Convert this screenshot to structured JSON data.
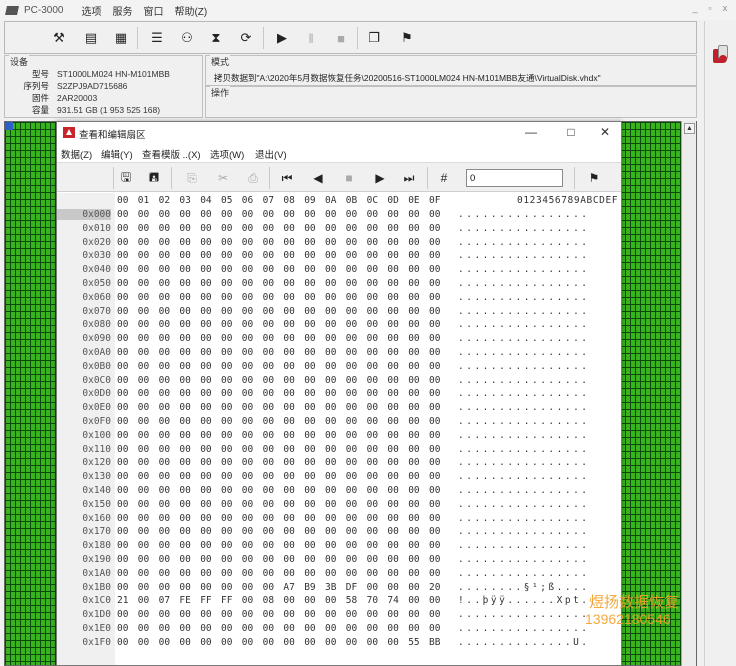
{
  "app": {
    "title": "PC-3000",
    "menu": [
      "选项",
      "服务",
      "窗口",
      "帮助(Z)"
    ],
    "window_controls": [
      "_",
      "▫",
      "x"
    ]
  },
  "device": {
    "caption": "设备",
    "fields": [
      {
        "label": "型号",
        "value": "ST1000LM024 HN-M101MBB"
      },
      {
        "label": "序列号",
        "value": "S2ZPJ9AD715686"
      },
      {
        "label": "固件",
        "value": "2AR20003"
      },
      {
        "label": "容量",
        "value": "931.51 GB (1 953 525 168)"
      }
    ]
  },
  "mode": {
    "caption": "模式",
    "text": "拷贝数据到\"A:\\2020年5月数据恢复任务\\20200516-ST1000LM024 HN-M101MBB友通\\VirtualDisk.vhdx\""
  },
  "operation": {
    "caption": "操作"
  },
  "editor": {
    "title": "查看和编辑扇区",
    "menu": [
      "数据(Z)",
      "编辑(Y)",
      "查看模版 ..(X)",
      "选项(W)",
      "退出(V)"
    ],
    "offset_value": "0",
    "column_headers": [
      "00",
      "01",
      "02",
      "03",
      "04",
      "05",
      "06",
      "07",
      "08",
      "09",
      "0A",
      "0B",
      "0C",
      "0D",
      "0E",
      "0F"
    ],
    "ascii_header": "0123456789ABCDEF",
    "rows": [
      {
        "addr": "0x000",
        "bytes": [
          "00",
          "00",
          "00",
          "00",
          "00",
          "00",
          "00",
          "00",
          "00",
          "00",
          "00",
          "00",
          "00",
          "00",
          "00",
          "00"
        ],
        "ascii": "................"
      },
      {
        "addr": "0x010",
        "bytes": [
          "00",
          "00",
          "00",
          "00",
          "00",
          "00",
          "00",
          "00",
          "00",
          "00",
          "00",
          "00",
          "00",
          "00",
          "00",
          "00"
        ],
        "ascii": "................"
      },
      {
        "addr": "0x020",
        "bytes": [
          "00",
          "00",
          "00",
          "00",
          "00",
          "00",
          "00",
          "00",
          "00",
          "00",
          "00",
          "00",
          "00",
          "00",
          "00",
          "00"
        ],
        "ascii": "................"
      },
      {
        "addr": "0x030",
        "bytes": [
          "00",
          "00",
          "00",
          "00",
          "00",
          "00",
          "00",
          "00",
          "00",
          "00",
          "00",
          "00",
          "00",
          "00",
          "00",
          "00"
        ],
        "ascii": "................"
      },
      {
        "addr": "0x040",
        "bytes": [
          "00",
          "00",
          "00",
          "00",
          "00",
          "00",
          "00",
          "00",
          "00",
          "00",
          "00",
          "00",
          "00",
          "00",
          "00",
          "00"
        ],
        "ascii": "................"
      },
      {
        "addr": "0x050",
        "bytes": [
          "00",
          "00",
          "00",
          "00",
          "00",
          "00",
          "00",
          "00",
          "00",
          "00",
          "00",
          "00",
          "00",
          "00",
          "00",
          "00"
        ],
        "ascii": "................"
      },
      {
        "addr": "0x060",
        "bytes": [
          "00",
          "00",
          "00",
          "00",
          "00",
          "00",
          "00",
          "00",
          "00",
          "00",
          "00",
          "00",
          "00",
          "00",
          "00",
          "00"
        ],
        "ascii": "................"
      },
      {
        "addr": "0x070",
        "bytes": [
          "00",
          "00",
          "00",
          "00",
          "00",
          "00",
          "00",
          "00",
          "00",
          "00",
          "00",
          "00",
          "00",
          "00",
          "00",
          "00"
        ],
        "ascii": "................"
      },
      {
        "addr": "0x080",
        "bytes": [
          "00",
          "00",
          "00",
          "00",
          "00",
          "00",
          "00",
          "00",
          "00",
          "00",
          "00",
          "00",
          "00",
          "00",
          "00",
          "00"
        ],
        "ascii": "................"
      },
      {
        "addr": "0x090",
        "bytes": [
          "00",
          "00",
          "00",
          "00",
          "00",
          "00",
          "00",
          "00",
          "00",
          "00",
          "00",
          "00",
          "00",
          "00",
          "00",
          "00"
        ],
        "ascii": "................"
      },
      {
        "addr": "0x0A0",
        "bytes": [
          "00",
          "00",
          "00",
          "00",
          "00",
          "00",
          "00",
          "00",
          "00",
          "00",
          "00",
          "00",
          "00",
          "00",
          "00",
          "00"
        ],
        "ascii": "................"
      },
      {
        "addr": "0x0B0",
        "bytes": [
          "00",
          "00",
          "00",
          "00",
          "00",
          "00",
          "00",
          "00",
          "00",
          "00",
          "00",
          "00",
          "00",
          "00",
          "00",
          "00"
        ],
        "ascii": "................"
      },
      {
        "addr": "0x0C0",
        "bytes": [
          "00",
          "00",
          "00",
          "00",
          "00",
          "00",
          "00",
          "00",
          "00",
          "00",
          "00",
          "00",
          "00",
          "00",
          "00",
          "00"
        ],
        "ascii": "................"
      },
      {
        "addr": "0x0D0",
        "bytes": [
          "00",
          "00",
          "00",
          "00",
          "00",
          "00",
          "00",
          "00",
          "00",
          "00",
          "00",
          "00",
          "00",
          "00",
          "00",
          "00"
        ],
        "ascii": "................"
      },
      {
        "addr": "0x0E0",
        "bytes": [
          "00",
          "00",
          "00",
          "00",
          "00",
          "00",
          "00",
          "00",
          "00",
          "00",
          "00",
          "00",
          "00",
          "00",
          "00",
          "00"
        ],
        "ascii": "................"
      },
      {
        "addr": "0x0F0",
        "bytes": [
          "00",
          "00",
          "00",
          "00",
          "00",
          "00",
          "00",
          "00",
          "00",
          "00",
          "00",
          "00",
          "00",
          "00",
          "00",
          "00"
        ],
        "ascii": "................"
      },
      {
        "addr": "0x100",
        "bytes": [
          "00",
          "00",
          "00",
          "00",
          "00",
          "00",
          "00",
          "00",
          "00",
          "00",
          "00",
          "00",
          "00",
          "00",
          "00",
          "00"
        ],
        "ascii": "................"
      },
      {
        "addr": "0x110",
        "bytes": [
          "00",
          "00",
          "00",
          "00",
          "00",
          "00",
          "00",
          "00",
          "00",
          "00",
          "00",
          "00",
          "00",
          "00",
          "00",
          "00"
        ],
        "ascii": "................"
      },
      {
        "addr": "0x120",
        "bytes": [
          "00",
          "00",
          "00",
          "00",
          "00",
          "00",
          "00",
          "00",
          "00",
          "00",
          "00",
          "00",
          "00",
          "00",
          "00",
          "00"
        ],
        "ascii": "................"
      },
      {
        "addr": "0x130",
        "bytes": [
          "00",
          "00",
          "00",
          "00",
          "00",
          "00",
          "00",
          "00",
          "00",
          "00",
          "00",
          "00",
          "00",
          "00",
          "00",
          "00"
        ],
        "ascii": "................"
      },
      {
        "addr": "0x140",
        "bytes": [
          "00",
          "00",
          "00",
          "00",
          "00",
          "00",
          "00",
          "00",
          "00",
          "00",
          "00",
          "00",
          "00",
          "00",
          "00",
          "00"
        ],
        "ascii": "................"
      },
      {
        "addr": "0x150",
        "bytes": [
          "00",
          "00",
          "00",
          "00",
          "00",
          "00",
          "00",
          "00",
          "00",
          "00",
          "00",
          "00",
          "00",
          "00",
          "00",
          "00"
        ],
        "ascii": "................"
      },
      {
        "addr": "0x160",
        "bytes": [
          "00",
          "00",
          "00",
          "00",
          "00",
          "00",
          "00",
          "00",
          "00",
          "00",
          "00",
          "00",
          "00",
          "00",
          "00",
          "00"
        ],
        "ascii": "................"
      },
      {
        "addr": "0x170",
        "bytes": [
          "00",
          "00",
          "00",
          "00",
          "00",
          "00",
          "00",
          "00",
          "00",
          "00",
          "00",
          "00",
          "00",
          "00",
          "00",
          "00"
        ],
        "ascii": "................"
      },
      {
        "addr": "0x180",
        "bytes": [
          "00",
          "00",
          "00",
          "00",
          "00",
          "00",
          "00",
          "00",
          "00",
          "00",
          "00",
          "00",
          "00",
          "00",
          "00",
          "00"
        ],
        "ascii": "................"
      },
      {
        "addr": "0x190",
        "bytes": [
          "00",
          "00",
          "00",
          "00",
          "00",
          "00",
          "00",
          "00",
          "00",
          "00",
          "00",
          "00",
          "00",
          "00",
          "00",
          "00"
        ],
        "ascii": "................"
      },
      {
        "addr": "0x1A0",
        "bytes": [
          "00",
          "00",
          "00",
          "00",
          "00",
          "00",
          "00",
          "00",
          "00",
          "00",
          "00",
          "00",
          "00",
          "00",
          "00",
          "00"
        ],
        "ascii": "................"
      },
      {
        "addr": "0x1B0",
        "bytes": [
          "00",
          "00",
          "00",
          "00",
          "00",
          "00",
          "00",
          "00",
          "A7",
          "B9",
          "3B",
          "DF",
          "00",
          "00",
          "00",
          "20"
        ],
        "ascii": "........§¹;ß...."
      },
      {
        "addr": "0x1C0",
        "bytes": [
          "21",
          "00",
          "07",
          "FE",
          "FF",
          "FF",
          "00",
          "08",
          "00",
          "00",
          "00",
          "58",
          "70",
          "74",
          "00",
          "00"
        ],
        "ascii": "!..þÿÿ......Xpt.."
      },
      {
        "addr": "0x1D0",
        "bytes": [
          "00",
          "00",
          "00",
          "00",
          "00",
          "00",
          "00",
          "00",
          "00",
          "00",
          "00",
          "00",
          "00",
          "00",
          "00",
          "00"
        ],
        "ascii": "................"
      },
      {
        "addr": "0x1E0",
        "bytes": [
          "00",
          "00",
          "00",
          "00",
          "00",
          "00",
          "00",
          "00",
          "00",
          "00",
          "00",
          "00",
          "00",
          "00",
          "00",
          "00"
        ],
        "ascii": "................"
      },
      {
        "addr": "0x1F0",
        "bytes": [
          "00",
          "00",
          "00",
          "00",
          "00",
          "00",
          "00",
          "00",
          "00",
          "00",
          "00",
          "00",
          "00",
          "00",
          "55",
          "BB"
        ],
        "ascii": "..............U."
      }
    ]
  },
  "watermark": {
    "line1": "煜扬数据恢复",
    "line2": "13962180546"
  },
  "colors": {
    "sector_ok": "#38b21d",
    "sector_grid": "#0c4a0c",
    "editor_logo": "#c7242c",
    "watermark": "#f5a02a"
  }
}
